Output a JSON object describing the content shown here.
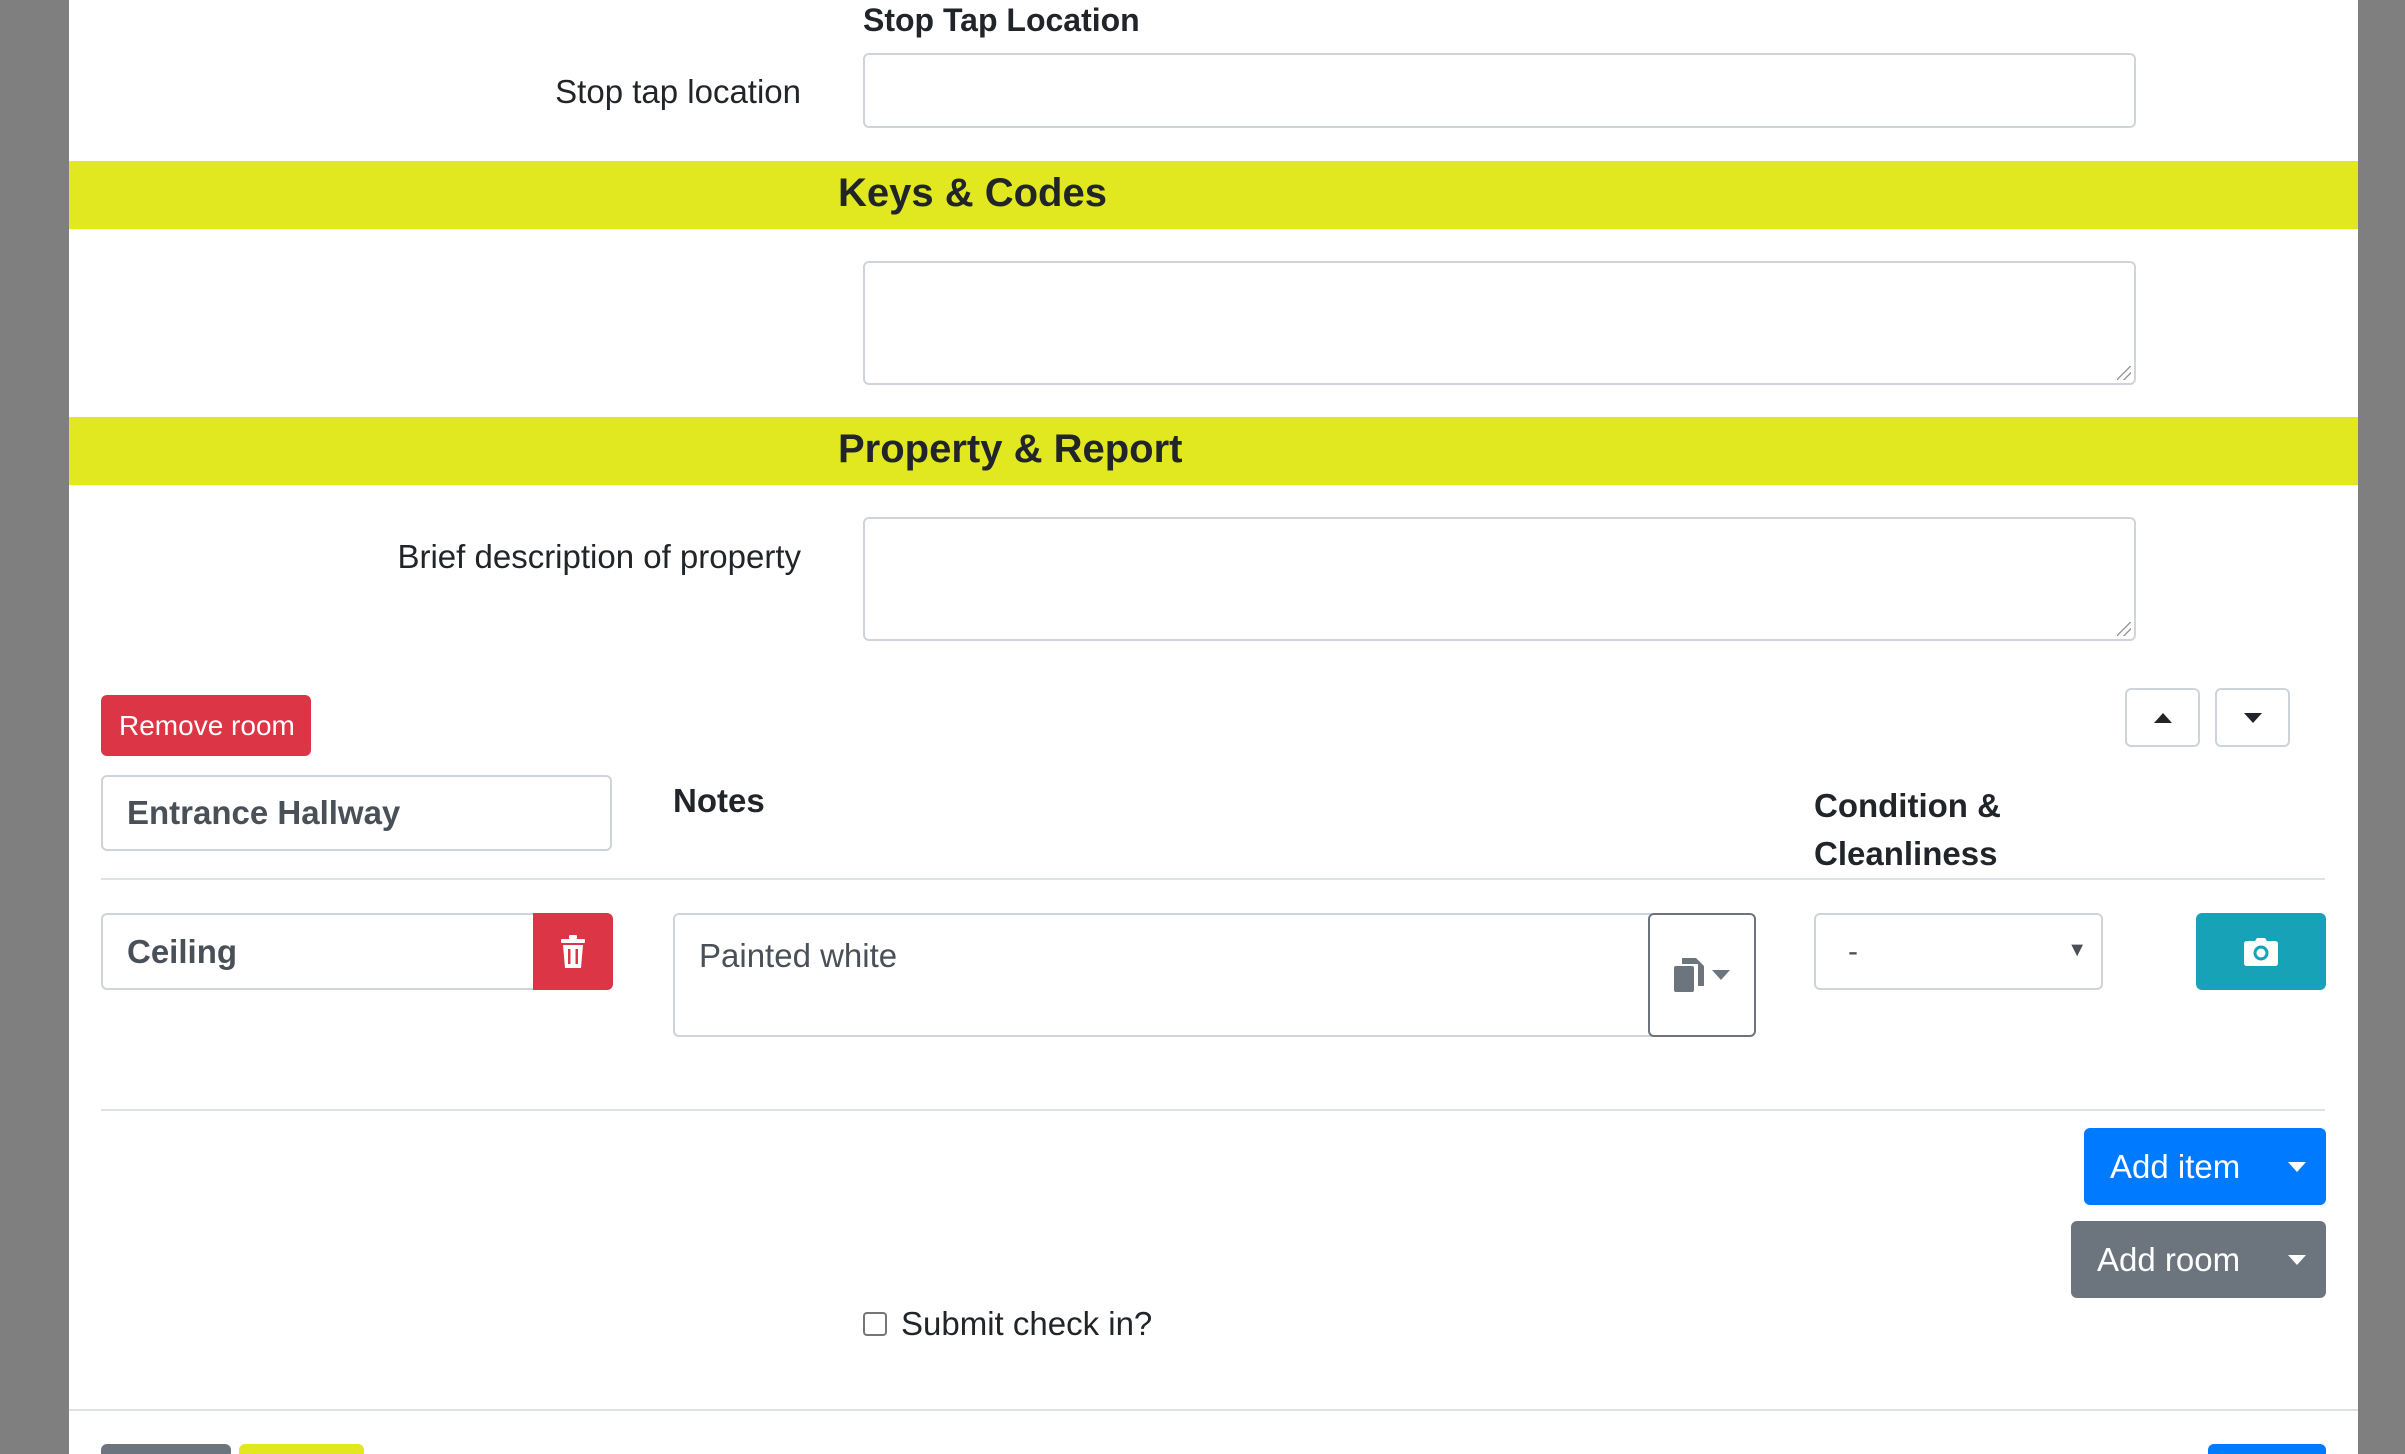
{
  "form": {
    "stop_tap": {
      "heading": "Stop Tap Location",
      "label": "Stop tap location",
      "value": ""
    },
    "keys_codes": {
      "heading": "Keys & Codes",
      "value": ""
    },
    "property_report": {
      "heading": "Property & Report",
      "description_label": "Brief description of property",
      "description_value": ""
    }
  },
  "room": {
    "remove_label": "Remove room",
    "name": "Entrance Hallway",
    "notes_header": "Notes",
    "condition_header_line1": "Condition &",
    "condition_header_line2": "Cleanliness",
    "items": [
      {
        "name": "Ceiling",
        "notes": "Painted white",
        "condition": "-"
      }
    ],
    "add_item_label": "Add item",
    "add_room_label": "Add room"
  },
  "submit": {
    "checkbox_label": "Submit check in?",
    "checked": false
  },
  "colors": {
    "section_band": "#e2e81f",
    "danger": "#dc3545",
    "primary": "#007bff",
    "secondary": "#6c757d",
    "info": "#17a2b8",
    "overlay": "#7f7f7f"
  },
  "icons": {
    "delete_item": "trash-icon",
    "copy_notes": "copy-icon",
    "photo": "camera-icon",
    "move_up": "caret-up-icon",
    "move_down": "caret-down-icon"
  }
}
